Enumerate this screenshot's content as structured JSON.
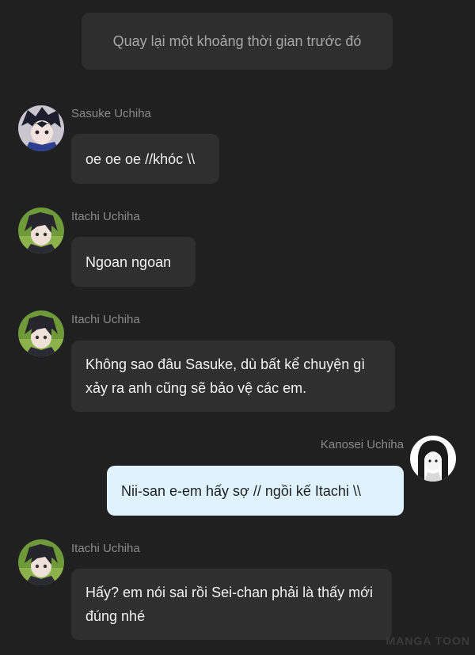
{
  "system_message": "Quay lại một khoảng thời gian trước đó",
  "messages": [
    {
      "sender": "Sasuke Uchiha",
      "text": "oe oe oe //khóc \\\\",
      "avatar_icon": "sasuke-avatar"
    },
    {
      "sender": "Itachi Uchiha",
      "text": "Ngoan ngoan",
      "avatar_icon": "itachi-avatar"
    },
    {
      "sender": "Itachi Uchiha",
      "text": "Không sao đâu Sasuke, dù bất kể chuyện gì xảy ra anh cũng sẽ bảo vệ các em.",
      "avatar_icon": "itachi-avatar"
    },
    {
      "sender": "Kanosei Uchiha",
      "text": "Nii-san e-em hấy sợ // ngồi kế Itachi \\\\",
      "avatar_icon": "kanosei-avatar",
      "outgoing": true
    },
    {
      "sender": "Itachi Uchiha",
      "text": "Hấy? em nói sai rồi Sei-chan phải là thấy mới đúng nhé",
      "avatar_icon": "itachi-avatar"
    }
  ],
  "watermark": "MANGA TOON",
  "colors": {
    "background": "#202020",
    "incoming_bubble": "#2f2f2f",
    "outgoing_bubble": "#dff3ff",
    "sender_text": "#8a8a8a"
  }
}
